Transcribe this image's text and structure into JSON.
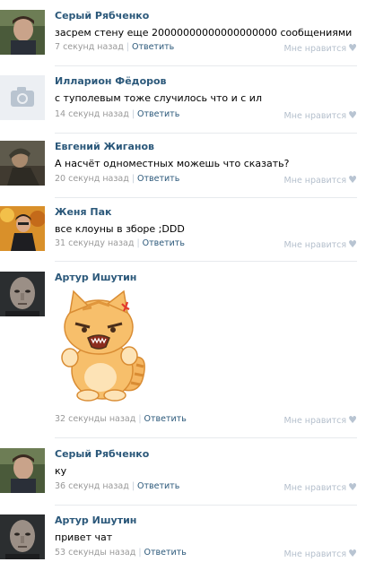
{
  "comments": [
    {
      "author": "Серый Рябченко",
      "text": "засрем стену еще 20000000000000000000 сообщениями",
      "time": "7 секунд назад",
      "reply": "Ответить",
      "like": "Мне нравится",
      "avatar": "avatar-photo-young-man"
    },
    {
      "author": "Илларион Фёдоров",
      "text": "с туполевым тоже случилось что и с ил",
      "time": "14 секунд назад",
      "reply": "Ответить",
      "like": "Мне нравится",
      "avatar": "camera-placeholder-icon"
    },
    {
      "author": "Евгений Жиганов",
      "text": "А насчёт одноместных можешь что сказать?",
      "time": "20 секунд назад",
      "reply": "Ответить",
      "like": "Мне нравится",
      "avatar": "avatar-photo-soldier"
    },
    {
      "author": "Женя Пак",
      "text": "все клоуны в зборе ;DDD",
      "time": "31 секунду назад",
      "reply": "Ответить",
      "like": "Мне нравится",
      "avatar": "avatar-photo-autumn"
    },
    {
      "author": "Артур Ишутин",
      "text": "",
      "sticker": "angry-cat-sticker",
      "time": "32 секунды назад",
      "reply": "Ответить",
      "like": "Мне нравится",
      "avatar": "avatar-photo-bald-man"
    },
    {
      "author": "Серый Рябченко",
      "text": "ку",
      "time": "36 секунд назад",
      "reply": "Ответить",
      "like": "Мне нравится",
      "avatar": "avatar-photo-young-man"
    },
    {
      "author": "Артур Ишутин",
      "text": "привет чат",
      "time": "53 секунды назад",
      "reply": "Ответить",
      "like": "Мне нравится",
      "avatar": "avatar-photo-bald-man"
    }
  ],
  "colors": {
    "author": "#2b587a",
    "meta": "#999999",
    "like": "#b4bfcc",
    "divider": "#e7eaed"
  }
}
